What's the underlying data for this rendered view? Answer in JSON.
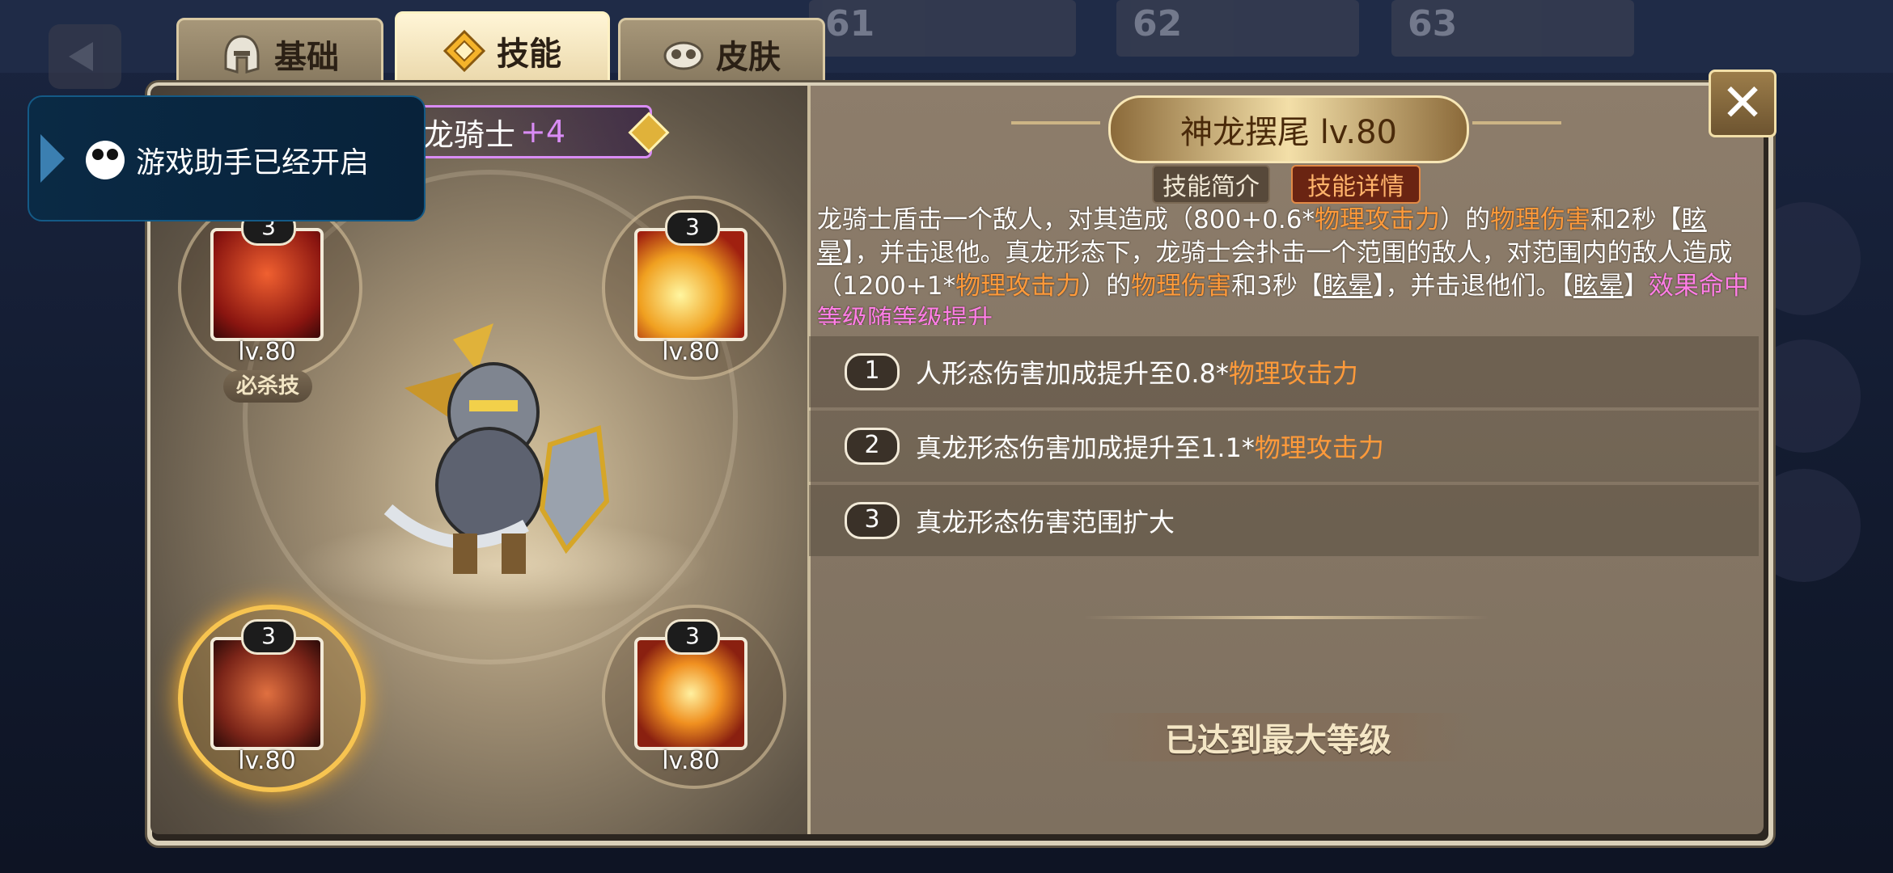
{
  "tabs": [
    {
      "label": "基础",
      "icon": "helmet-icon",
      "active": false
    },
    {
      "label": "技能",
      "icon": "skill-diamond-icon",
      "active": true
    },
    {
      "label": "皮肤",
      "icon": "mask-icon",
      "active": false
    }
  ],
  "background": {
    "stats": [
      "61",
      "62",
      "63"
    ]
  },
  "toast": {
    "text": "游戏助手已经开启"
  },
  "hero": {
    "name": "龙骑士",
    "plus": "+4"
  },
  "skills": [
    {
      "level_badge": "3",
      "lv": "lv.80",
      "tag": "必杀技",
      "icon": "dragon-head-icon"
    },
    {
      "level_badge": "3",
      "lv": "lv.80",
      "icon": "dragon-breath-icon"
    },
    {
      "level_badge": "3",
      "lv": "lv.80",
      "icon": "dragon-tail-icon",
      "selected": true
    },
    {
      "level_badge": "3",
      "lv": "lv.80",
      "icon": "dragon-burst-icon"
    }
  ],
  "skill_detail": {
    "title": "神龙摆尾 lv.80",
    "subtab_intro": "技能简介",
    "subtab_detail": "技能详情",
    "desc": {
      "p1": "龙骑士盾击一个敌人，对其造成（800+0.6*",
      "k1": "物理攻击力",
      "p2": "）的",
      "k2": "物理伤害",
      "p3": "和2秒【",
      "k3": "眩晕",
      "p4": "】，并击退他。真龙形态下，龙骑士会扑击一个范围的敌人，对范围内的敌人造成（1200+1*",
      "k4": "物理攻击力",
      "p5": "）的",
      "k5": "物理伤害",
      "p6": "和3秒【",
      "k6": "眩晕",
      "p7": "】，并击退他们。【",
      "k7": "眩晕",
      "p8": "】",
      "k8": "效果命中等级随等级提升"
    },
    "upgrades": [
      {
        "num": "1",
        "text": "人形态伤害加成提升至0.8*",
        "key": "物理攻击力"
      },
      {
        "num": "2",
        "text": "真龙形态伤害加成提升至1.1*",
        "key": "物理攻击力"
      },
      {
        "num": "3",
        "text": "真龙形态伤害范围扩大",
        "key": ""
      }
    ],
    "max_label": "已达到最大等级"
  },
  "colors": {
    "highlight": "#ff9a3a",
    "status_pink": "#ff7ee6",
    "accent_gold": "#f7c450"
  }
}
